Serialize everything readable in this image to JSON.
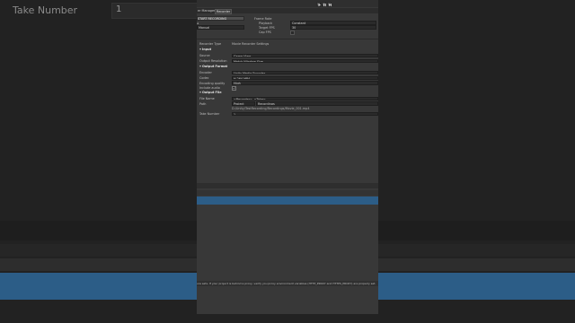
{
  "background": {
    "take_number_label": "Take Number",
    "take_number_value": "1",
    "status_message": "ure sets. If your project is behind a proxy, verify you proxy environment variables (HTTP_PROXY and HTTPS_PROXY) are properly set."
  },
  "toolbar": {
    "play_icon": "play-icon",
    "pause_icon": "pause-icon",
    "step_icon": "step-icon"
  },
  "tabs": [
    {
      "label": "er Manager"
    },
    {
      "label": "Recorder"
    }
  ],
  "recorder": {
    "start_recording_label": "START RECORDING",
    "frame_rate_label": "Frame Rate",
    "playback_label": "Playback",
    "playback_value": "Constant",
    "target_fps_label": "Target FPS",
    "target_fps_value": "30",
    "cap_fps_label": "Cap FPS",
    "mode_value": "Manual",
    "recorder_type_label": "Recorder Type",
    "recorder_type_value": "Movie Recorder Settings",
    "input_section": "Input",
    "source_label": "Source",
    "source_value": "Game View",
    "output_resolution_label": "Output Resolution",
    "output_resolution_value": "Match Window Size",
    "output_format_section": "Output Format",
    "encoder_label": "Encoder",
    "encoder_value": "Unity Media Encoder",
    "codec_label": "Codec",
    "codec_value": "H.264 MP4",
    "encoding_quality_label": "Encoding quality",
    "encoding_quality_value": "High",
    "include_audio_label": "Include audio",
    "output_file_section": "Output File",
    "file_name_label": "File Name",
    "file_name_value": "<Recorder>_<Take>",
    "path_label": "Path",
    "path_value": "Project",
    "path_folder_value": "Recordings",
    "full_path_value": "D:/Unity/TestRecording/Recordings/Movie_001.mp4",
    "take_number_label": "Take Number",
    "take_number_value": "1"
  },
  "colors": {
    "selection": "#2c5d87",
    "window_bg": "#383838"
  }
}
